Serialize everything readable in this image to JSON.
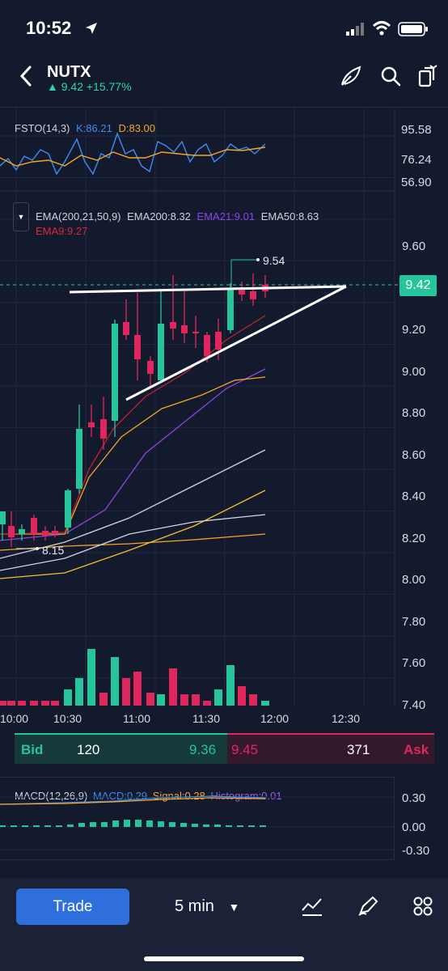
{
  "status": {
    "time": "10:52"
  },
  "nav": {
    "symbol": "NUTX",
    "change": "▲ 9.42 +15.77%"
  },
  "fsto": {
    "name": "FSTO(14,3)",
    "k": "K:86.21",
    "d": "D:83.00",
    "axis": [
      "95.58",
      "76.24",
      "56.90"
    ]
  },
  "ema": {
    "name": "EMA(200,21,50,9)",
    "ema200": "EMA200:8.32",
    "ema21": "EMA21:9.01",
    "ema50": "EMA50:8.63",
    "ema9": "EMA9:9.27"
  },
  "price": {
    "current": "9.42",
    "high_label": "9.54",
    "low_label": "8.15",
    "axis": [
      "9.60",
      "9.40",
      "9.20",
      "9.00",
      "8.80",
      "8.60",
      "8.40",
      "8.20",
      "8.00",
      "7.80",
      "7.60",
      "7.40"
    ]
  },
  "time_axis": [
    "10:00",
    "10:30",
    "11:00",
    "11:30",
    "12:00",
    "12:30"
  ],
  "bidask": {
    "bid_label": "Bid",
    "bid_size": "120",
    "bid_price": "9.36",
    "ask_price": "9.45",
    "ask_size": "371",
    "ask_label": "Ask"
  },
  "macd": {
    "name": "MACD(12,26,9)",
    "macd": "MACD:0.29",
    "signal": "Signal:0.28",
    "histogram": "Histogram:0.01",
    "axis": [
      "0.30",
      "0.00",
      "-0.30"
    ]
  },
  "toolbar": {
    "trade": "Trade",
    "interval": "5 min"
  },
  "icons": [
    "back-icon",
    "draw-icon",
    "search-icon",
    "share-icon",
    "chevron-down-icon",
    "indicator-icon",
    "pen-icon",
    "grid-icon"
  ],
  "colors": {
    "up": "#26c49a",
    "down": "#e0275d",
    "ema200": "#f5a623",
    "ema21": "#8b46e0",
    "ema50": "#cfd3dc",
    "ema9": "#c0222c",
    "bg": "#141a2e"
  }
}
